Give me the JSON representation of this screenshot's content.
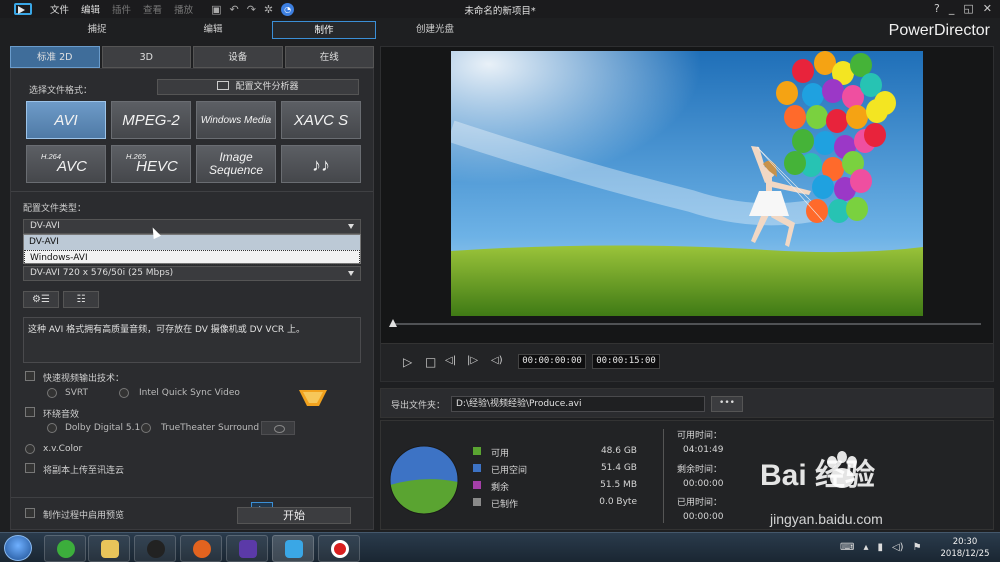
{
  "menu": {
    "items": [
      "文件",
      "编辑",
      "插件",
      "查看",
      "播放"
    ],
    "dim_from": 2
  },
  "window": {
    "title": "未命名的新项目*",
    "brand": "PowerDirector"
  },
  "window_controls": {
    "help": "?",
    "minimize": "_",
    "restore": "◱",
    "close": "✕"
  },
  "modes": [
    "捕捉",
    "编辑",
    "制作",
    "创建光盘"
  ],
  "subtabs": [
    "标准 2D",
    "3D",
    "设备",
    "在线"
  ],
  "produce": {
    "select_format_label": "选择文件格式：",
    "profile_analyzer_label": "配置文件分析器",
    "formats": {
      "avi": "AVI",
      "mpeg2": "MPEG-2",
      "wmv": "Windows Media",
      "xavcs": "XAVC S",
      "avc_sup": "H.264",
      "avc": "AVC",
      "hevc_sup": "H.265",
      "hevc": "HEVC",
      "imgseq_1": "Image",
      "imgseq_2": "Sequence",
      "audio": "♪♪"
    },
    "profile_type_label": "配置文件类型：",
    "profile_type_value": "DV-AVI",
    "dropdown_options": [
      "DV-AVI",
      "Windows-AVI"
    ],
    "profile_quality": "DV-AVI 720 x 576/50i (25 Mbps)",
    "settings_icon": "⚙☰",
    "list_icon": "☷",
    "description": "这种 AVI 格式拥有高质量音频，可存放在 DV 摄像机或 DV VCR 上。",
    "fast_render_label": "快速视频输出技术：",
    "svrt": "SVRT",
    "intel_qsv": "Intel Quick Sync Video",
    "surround_label": "环绕音效",
    "dolby": "Dolby Digital 5.1",
    "truetheater": "TrueTheater Surround",
    "xvcolor": "x.v.Color",
    "upload_cloud": "将副本上传至讯连云",
    "preview_during": "制作过程中启用预览",
    "start": "开始"
  },
  "player": {
    "play": "▷",
    "stop": "□",
    "prev_frame": "◁|",
    "next_frame": "|▷",
    "volume": "◁)",
    "timecode_current": "00:00:00:00",
    "timecode_total": "00:00:15:00"
  },
  "output": {
    "folder_label": "导出文件夹：",
    "folder_path": "D:\\经验\\视频经验\\Produce.avi",
    "browse_label": "•••"
  },
  "disk": {
    "items": [
      {
        "label": "可用",
        "value": "48.6  GB",
        "color": "#5aa431"
      },
      {
        "label": "已用空间",
        "value": "51.4  GB",
        "color": "#3d73c5"
      },
      {
        "label": "剩余",
        "value": "51.5  MB",
        "color": "#a43fa8"
      },
      {
        "label": "已制作",
        "value": "0.0  Byte",
        "color": "#8a8a8a"
      }
    ],
    "available_time_label": "可用时间：",
    "available_time": "04:01:49",
    "remaining_time_label": "剩余时间：",
    "remaining_time": "00:00:00",
    "elapsed_time_label": "已用时间：",
    "elapsed_time": "00:00:00"
  },
  "watermark": {
    "brand": "Bai  经验",
    "url": "jingyan.baidu.com"
  },
  "taskbar": {
    "time": "20:30",
    "date": "2018/12/25"
  },
  "colors": {
    "accent": "#3b8fd6",
    "selected_format": "#5a87b5"
  }
}
